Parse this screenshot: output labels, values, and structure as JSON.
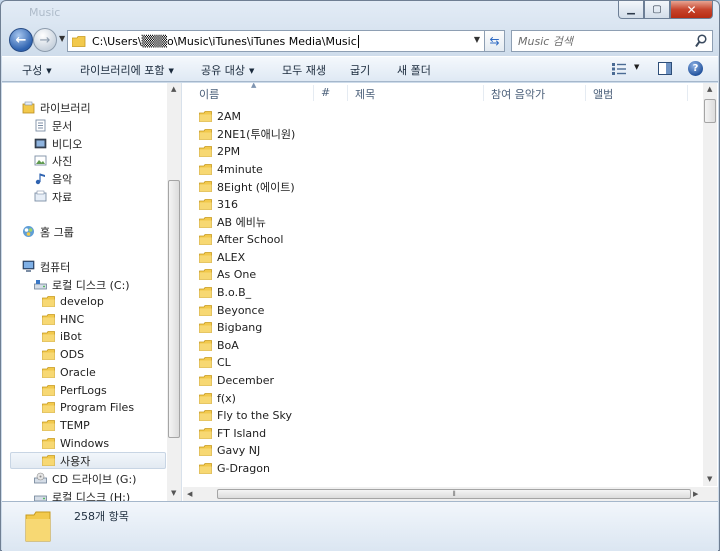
{
  "window": {
    "title": "Music"
  },
  "nav": {
    "address": "C:\\Users\\▒▒▒o\\Music\\iTunes\\iTunes Media\\Music",
    "search_placeholder": "Music 검색"
  },
  "toolbar": {
    "organize": "구성",
    "include_in_library": "라이브러리에 포함",
    "share_with": "공유 대상",
    "play_all": "모두 재생",
    "burn": "굽기",
    "new_folder": "새 폴더"
  },
  "sidebar": {
    "libraries": "라이브러리",
    "documents": "문서",
    "videos": "비디오",
    "pictures": "사진",
    "music": "음악",
    "data": "자료",
    "homegroup": "홈 그룹",
    "computer": "컴퓨터",
    "local_disk_c": "로컬 디스크 (C:)",
    "folders": [
      "develop",
      "HNC",
      "iBot",
      "ODS",
      "Oracle",
      "PerfLogs",
      "Program Files",
      "TEMP",
      "Windows",
      "사용자"
    ],
    "cd_drive": "CD 드라이브 (G:)",
    "local_disk_h": "로컬 디스크 (H:)"
  },
  "columns": {
    "name": "이름",
    "number": "#",
    "title": "제목",
    "artist": "참여 음악가",
    "album": "앨범"
  },
  "files": [
    "2AM",
    "2NE1(투애니원)",
    "2PM",
    "4minute",
    "8Eight (에이트)",
    "316",
    "AB 에비뉴",
    "After School",
    "ALEX",
    "As One",
    "B.o.B_",
    "Beyonce",
    "Bigbang",
    "BoA",
    "CL",
    "December",
    "f(x)",
    "Fly to the Sky",
    "FT Island",
    "Gavy NJ",
    "G-Dragon"
  ],
  "status": {
    "count": "258개 항목"
  },
  "colors": {
    "folder": "#f2c94c",
    "accent": "#2f63b0"
  }
}
